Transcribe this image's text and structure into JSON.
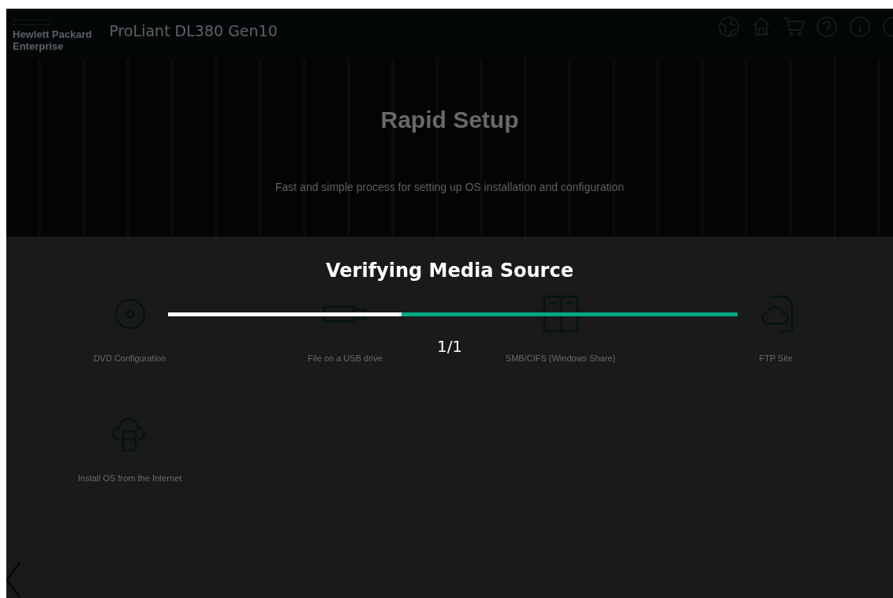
{
  "header": {
    "brand_line_1": "Hewlett Packard",
    "brand_line_2": "Enterprise",
    "product": "ProLiant DL380 Gen10"
  },
  "hero": {
    "title": "Rapid Setup",
    "subtitle": "Fast and simple process for setting up OS installation and configuration"
  },
  "options": [
    {
      "kind": "dvd",
      "label": "DVD Configuration"
    },
    {
      "kind": "usb",
      "label": "File on a USB drive"
    },
    {
      "kind": "share",
      "label": "SMB/CIFS (Windows Share)"
    },
    {
      "kind": "ftp",
      "label": "FTP Site"
    },
    {
      "kind": "internet",
      "label": "Install OS from the Internet"
    }
  ],
  "dialog": {
    "title": "Verifying Media Source",
    "progress": {
      "level": 0.41
    },
    "count": "1/1"
  }
}
